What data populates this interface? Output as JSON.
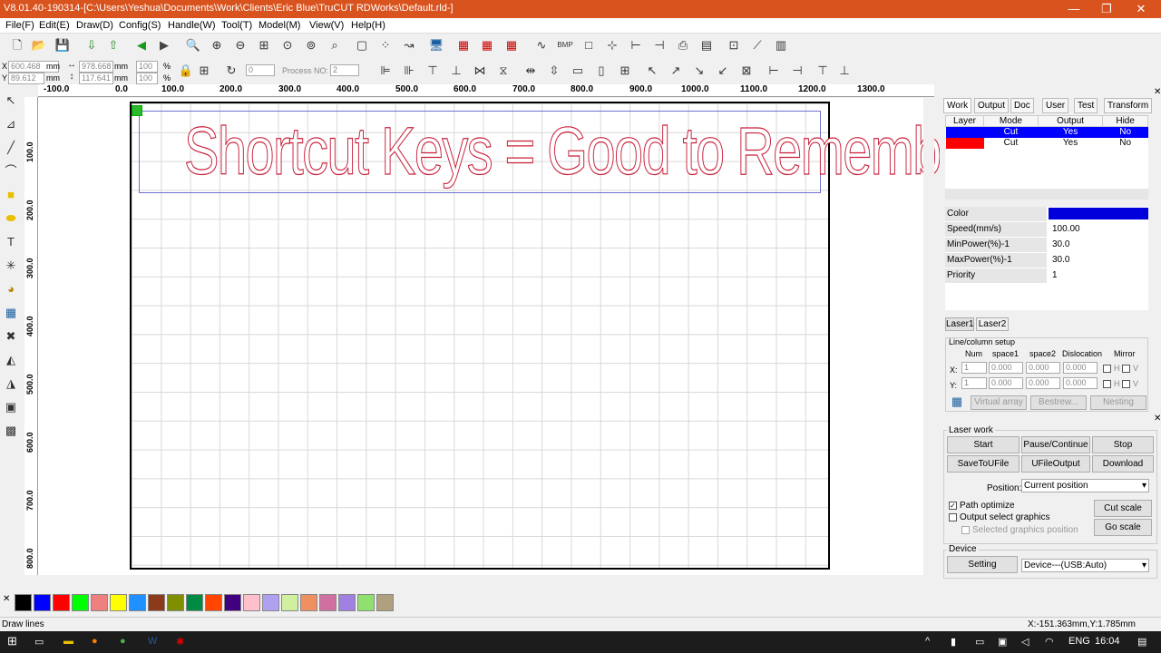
{
  "window": {
    "title": "V8.01.40-190314-[C:\\Users\\Yeshua\\Documents\\Work\\Clients\\Eric Blue\\TruCUT RDWorks\\Default.rld-]"
  },
  "menu": [
    "File(F)",
    "Edit(E)",
    "Draw(D)",
    "Config(S)",
    "Handle(W)",
    "Tool(T)",
    "Model(M)",
    "View(V)",
    "Help(H)"
  ],
  "coords": {
    "x": "600.468",
    "y": "89.612",
    "w": "978.668",
    "h": "117.641",
    "unit": "mm",
    "pw": "100",
    "ph": "100",
    "pct": "%",
    "xl": "X",
    "yl": "Y",
    "rot": "0",
    "process_label": "Process NO:",
    "process_no": "2"
  },
  "ruler_top": [
    "-100.0",
    "0.0",
    "100.0",
    "200.0",
    "300.0",
    "400.0",
    "500.0",
    "600.0",
    "700.0",
    "800.0",
    "900.0",
    "1000.0",
    "1100.0",
    "1200.0",
    "1300.0"
  ],
  "ruler_left": [
    "100.0",
    "200.0",
    "300.0",
    "400.0",
    "500.0",
    "600.0",
    "700.0",
    "800.0"
  ],
  "canvas": {
    "text": "Shortcut Keys = Good to Remember"
  },
  "panel": {
    "tabs": [
      "Work",
      "Output",
      "Doc",
      "User",
      "Test",
      "Transform"
    ],
    "layer_headers": [
      "Layer",
      "Mode",
      "Output",
      "Hide"
    ],
    "layers": [
      {
        "color": "#0000ff",
        "mode": "Cut",
        "output": "Yes",
        "hide": "No"
      },
      {
        "color": "#ff0000",
        "mode": "Cut",
        "output": "Yes",
        "hide": "No"
      }
    ],
    "props": [
      {
        "k": "Color",
        "v": ""
      },
      {
        "k": "Speed(mm/s)",
        "v": "100.00"
      },
      {
        "k": "MinPower(%)-1",
        "v": "30.0"
      },
      {
        "k": "MaxPower(%)-1",
        "v": "30.0"
      },
      {
        "k": "Priority",
        "v": "1"
      }
    ],
    "laser_tabs": [
      "Laser1",
      "Laser2"
    ],
    "array_title": "Line/column setup",
    "array_headers": [
      "Num",
      "space1",
      "space2",
      "Dislocation",
      "Mirror"
    ],
    "array_x": [
      "1",
      "0.000",
      "0.000",
      "0.000"
    ],
    "array_y": [
      "1",
      "0.000",
      "0.000",
      "0.000"
    ],
    "xlab": "X:",
    "ylab": "Y:",
    "h": "H",
    "v": "V",
    "array_buttons": [
      "Virtual array",
      "Bestrew...",
      "Nesting"
    ]
  },
  "laserwork": {
    "title": "Laser work",
    "start": "Start",
    "pause": "Pause/Continue",
    "stop": "Stop",
    "save": "SaveToUFile",
    "ufile": "UFileOutput",
    "download": "Download",
    "position_label": "Position:",
    "position_value": "Current position",
    "path_opt": "Path optimize",
    "output_sel": "Output select graphics",
    "selected_pos": "Selected graphics position",
    "cut_scale": "Cut scale",
    "go_scale": "Go scale",
    "device_title": "Device",
    "setting": "Setting",
    "device_value": "Device---(USB:Auto)"
  },
  "palette": [
    "#000000",
    "#0000ff",
    "#ff0000",
    "#00ff00",
    "#f08080",
    "#ffff00",
    "#1e90ff",
    "#8b3a1a",
    "#7f8f00",
    "#008b45",
    "#ff4500",
    "#400080",
    "#ffc0cb",
    "#b0a0f0",
    "#d0f0a0",
    "#f09060",
    "#d070a0",
    "#a080e0",
    "#90e070",
    "#b0a080"
  ],
  "status": {
    "left": "Draw lines",
    "right": "X:-151.363mm,Y:1.785mm"
  },
  "taskbar": {
    "lang": "ENG",
    "time": "16:04"
  }
}
